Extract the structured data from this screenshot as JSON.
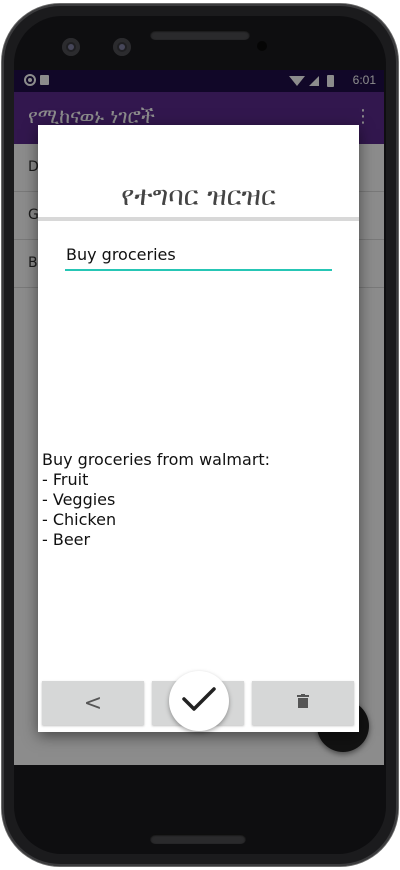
{
  "status_bar": {
    "time": "6:01"
  },
  "app_bar": {
    "title": "የሚከናወኑ ነገሮች"
  },
  "list_peek": [
    {
      "label": "D"
    },
    {
      "label": "G"
    },
    {
      "label": "B"
    }
  ],
  "dialog": {
    "title": "የተግባር ዝርዝር",
    "task_name": "Buy groceries",
    "description": "Buy groceries from walmart:\n- Fruit\n- Veggies\n- Chicken\n- Beer",
    "back_label": "<"
  },
  "icons": {
    "back_nav": "triangle-back-icon",
    "home_nav": "circle-home-icon",
    "recents_nav": "square-recents-icon",
    "confirm": "checkmark-icon",
    "delete": "trash-icon"
  },
  "colors": {
    "status_bar": "#1f0e4a",
    "app_bar": "#5b2b8e",
    "input_underline": "#26c6b5",
    "button_gray": "#d6d7d7"
  }
}
